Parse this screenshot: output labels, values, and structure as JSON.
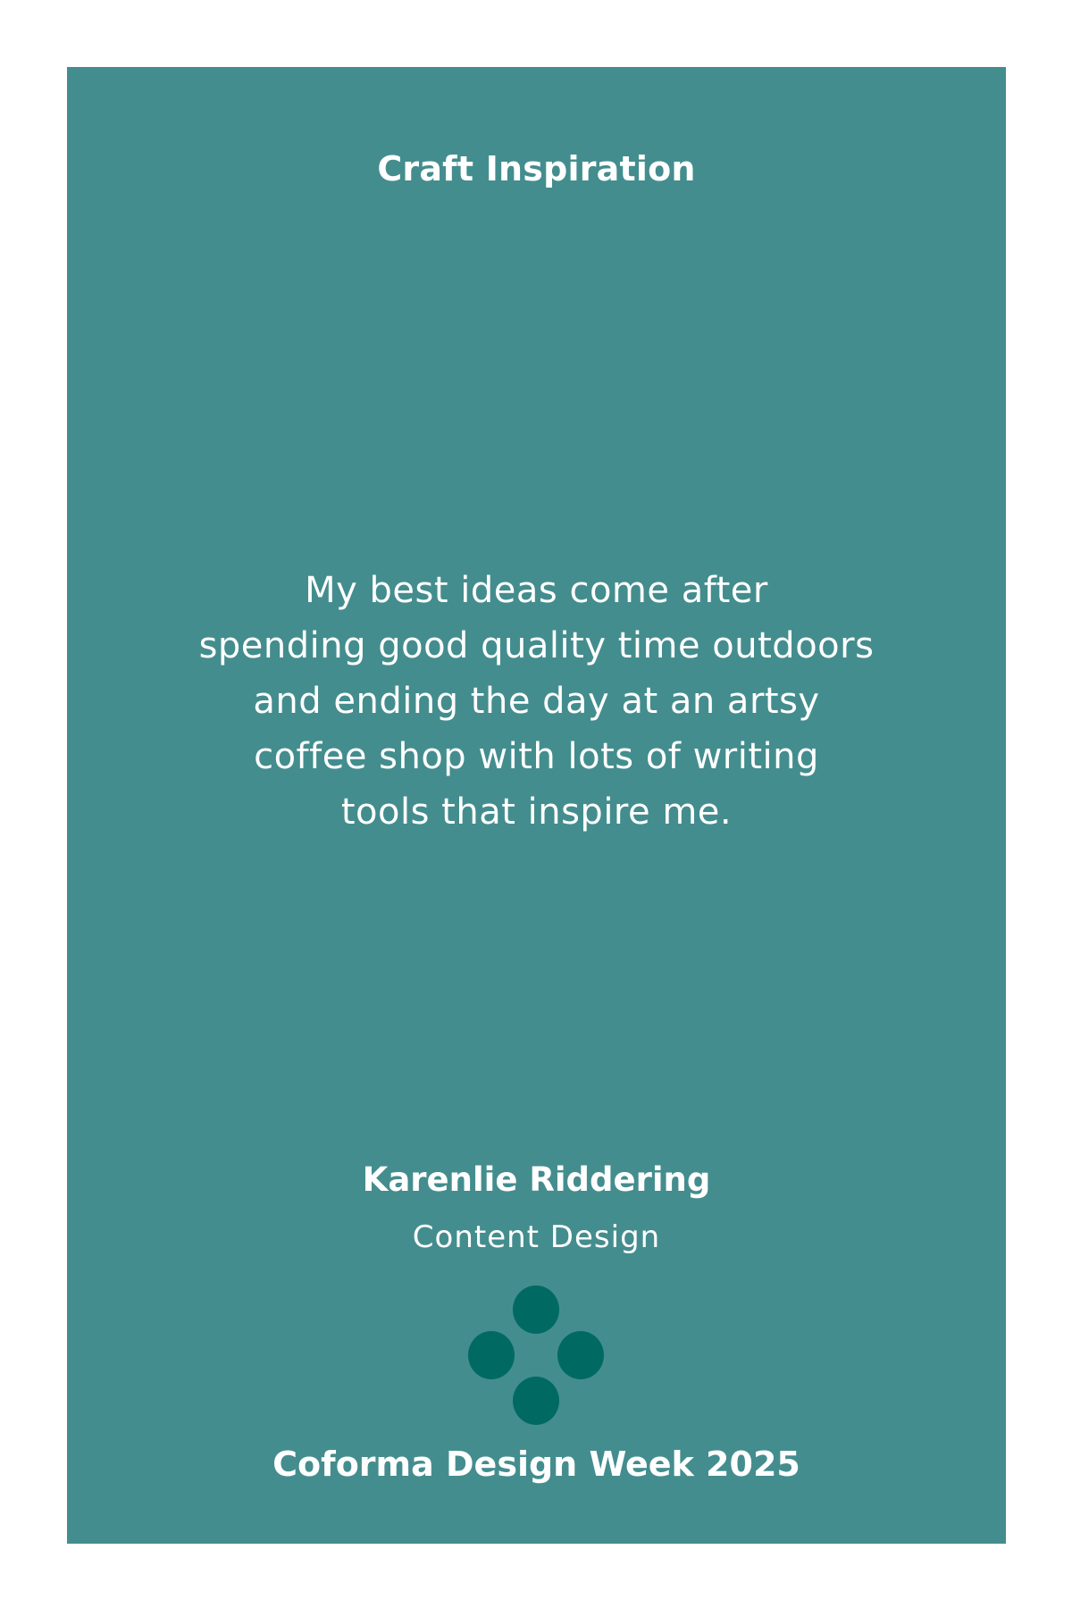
{
  "poster": {
    "title": "Craft Inspiration",
    "quote_lines": [
      "My best ideas come after",
      "spending good quality time outdoors",
      "and ending the day at an artsy",
      "coffee shop with lots of writing",
      "tools that inspire me."
    ],
    "author": "Karenlie Riddering",
    "role": "Content Design",
    "logo_icon": "four-dot-flower-icon",
    "footer": "Coforma Design Week 2025"
  },
  "colors": {
    "card_background": "#448d8e",
    "text": "#ffffff",
    "logo": "#006a62",
    "page_background": "#ffffff"
  }
}
